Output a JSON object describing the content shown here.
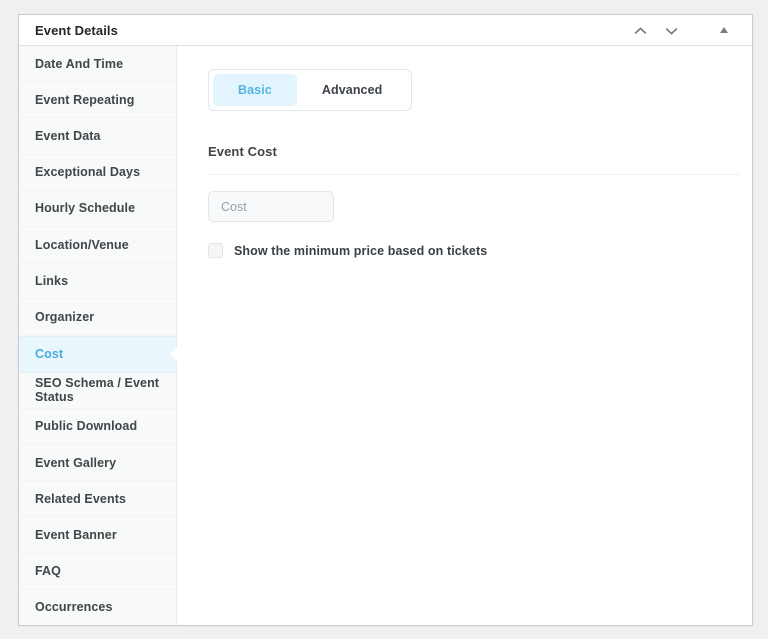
{
  "metabox": {
    "title": "Event Details",
    "controls": [
      {
        "name": "move-up",
        "icon": "chevron-up-icon"
      },
      {
        "name": "move-down",
        "icon": "chevron-down-icon"
      },
      {
        "name": "toggle-panel",
        "icon": "triangle-up-icon"
      }
    ]
  },
  "sidebar": {
    "items": [
      {
        "label": "Date And Time",
        "active": false
      },
      {
        "label": "Event Repeating",
        "active": false
      },
      {
        "label": "Event Data",
        "active": false
      },
      {
        "label": "Exceptional Days",
        "active": false
      },
      {
        "label": "Hourly Schedule",
        "active": false
      },
      {
        "label": "Location/Venue",
        "active": false
      },
      {
        "label": "Links",
        "active": false
      },
      {
        "label": "Organizer",
        "active": false
      },
      {
        "label": "Cost",
        "active": true
      },
      {
        "label": "SEO Schema / Event Status",
        "active": false
      },
      {
        "label": "Public Download",
        "active": false
      },
      {
        "label": "Event Gallery",
        "active": false
      },
      {
        "label": "Related Events",
        "active": false
      },
      {
        "label": "Event Banner",
        "active": false
      },
      {
        "label": "FAQ",
        "active": false
      },
      {
        "label": "Occurrences",
        "active": false
      }
    ]
  },
  "content": {
    "tabs": [
      {
        "label": "Basic",
        "active": true
      },
      {
        "label": "Advanced",
        "active": false
      }
    ],
    "section_title": "Event Cost",
    "cost_input": {
      "value": "",
      "placeholder": "Cost"
    },
    "min_price_checkbox": {
      "label": "Show the minimum price based on tickets",
      "checked": false
    }
  },
  "colors": {
    "page_bg": "#f0f0f1",
    "panel_border": "#c9ccd0",
    "sidebar_bg": "#f8f9f9",
    "accent_blue": "#49acdf",
    "active_item_bg": "#e9f6fc",
    "tab_active_bg": "#e2f4fd",
    "text_dark": "#3c4248",
    "icon_gray": "#787c82"
  }
}
